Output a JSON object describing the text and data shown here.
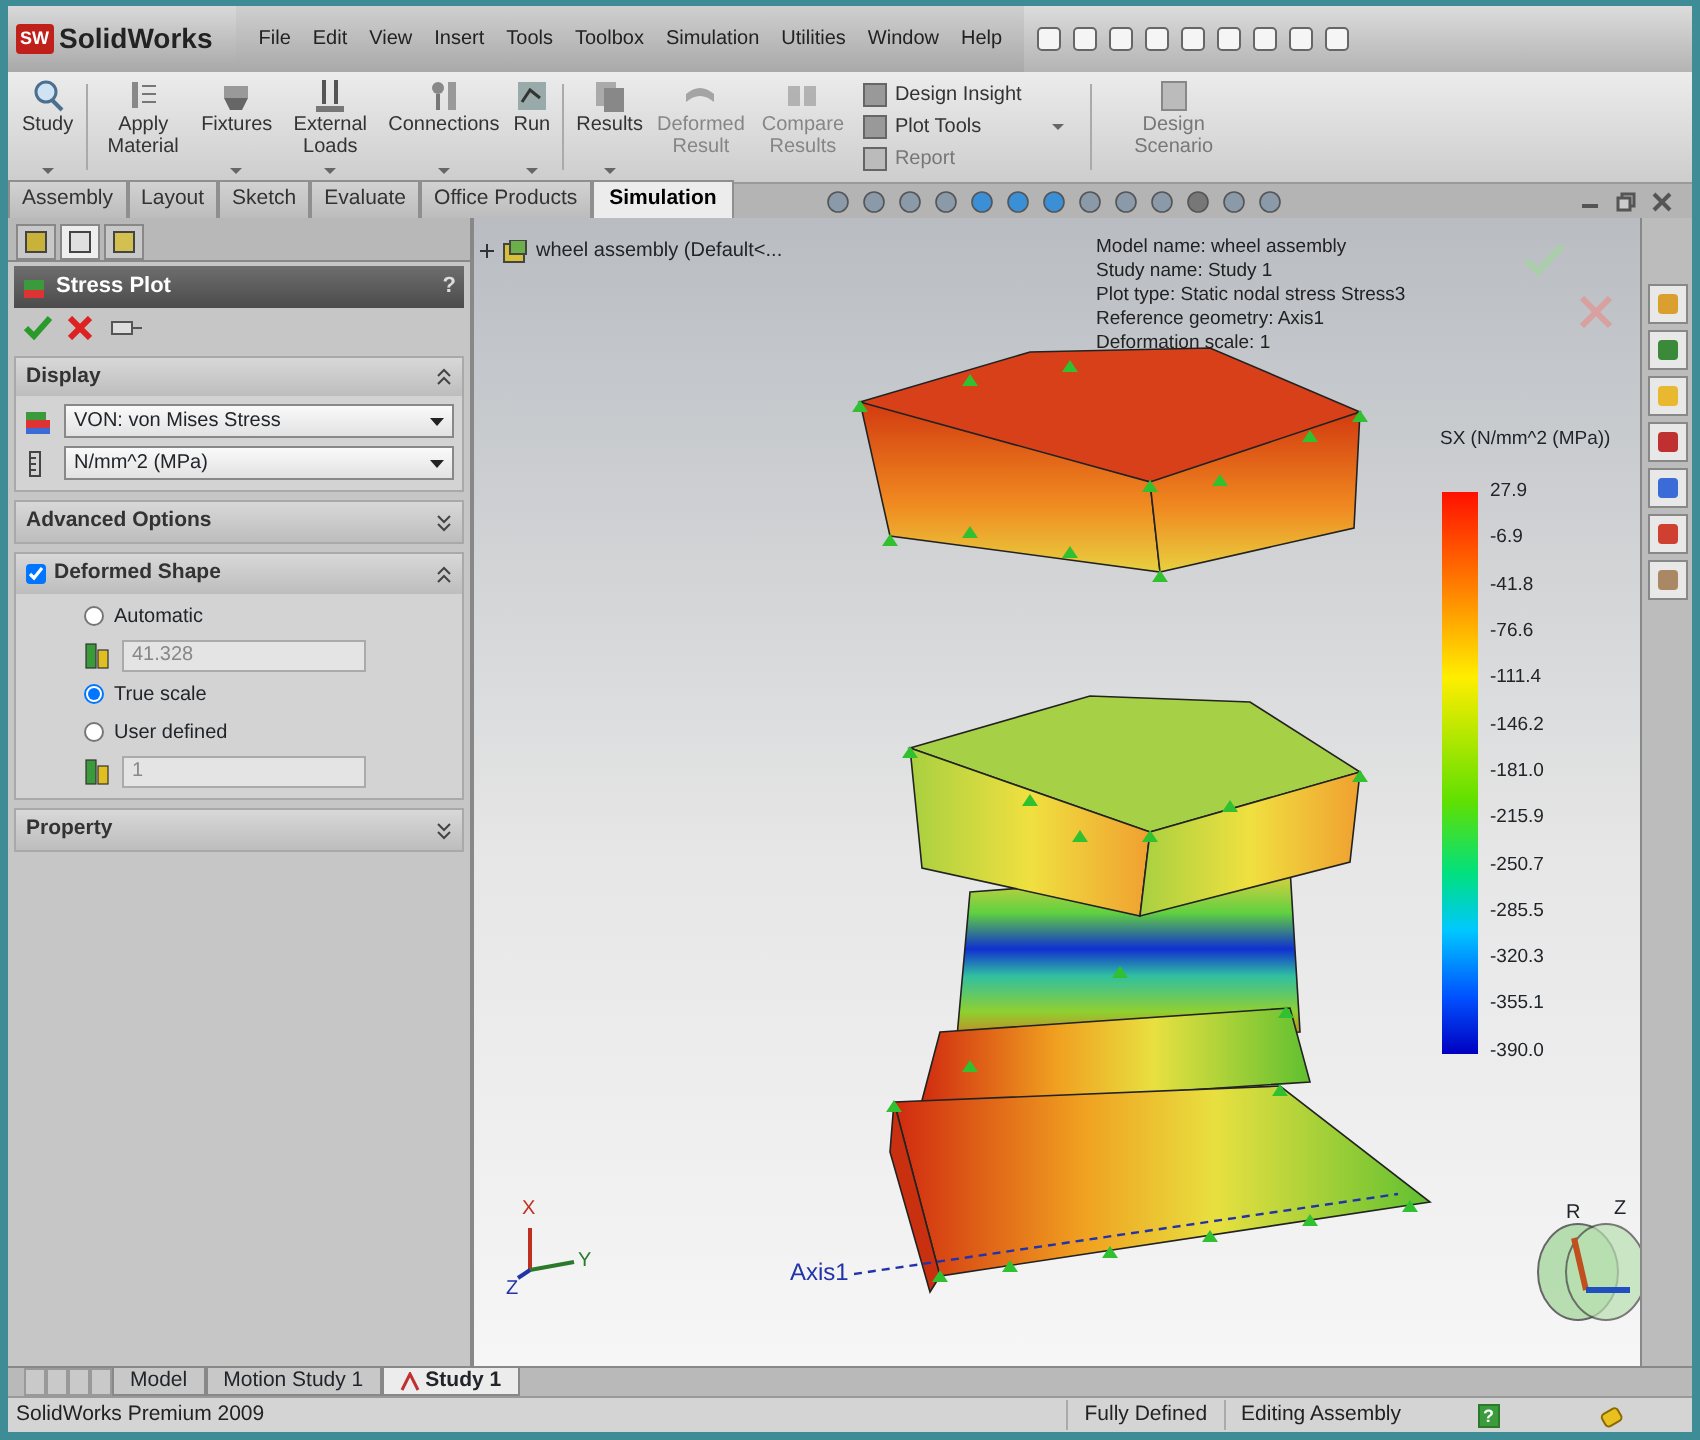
{
  "app": {
    "logo_badge": "SW",
    "logo": "SolidWorks",
    "menu": [
      "File",
      "Edit",
      "View",
      "Insert",
      "Tools",
      "Toolbox",
      "Simulation",
      "Utilities",
      "Window",
      "Help"
    ]
  },
  "ribbon": {
    "tools": [
      {
        "label": "Study",
        "has_menu": true,
        "disabled": false
      },
      {
        "label": "Apply Material",
        "has_menu": false,
        "disabled": false
      },
      {
        "label": "Fixtures",
        "has_menu": true,
        "disabled": false
      },
      {
        "label": "External Loads",
        "has_menu": true,
        "disabled": false
      },
      {
        "label": "Connections",
        "has_menu": true,
        "disabled": false
      },
      {
        "label": "Run",
        "has_menu": true,
        "disabled": false
      },
      {
        "label": "Results",
        "has_menu": true,
        "disabled": false
      },
      {
        "label": "Deformed Result",
        "has_menu": false,
        "disabled": true
      },
      {
        "label": "Compare Results",
        "has_menu": false,
        "disabled": true
      }
    ],
    "small_tools": [
      {
        "label": "Design Insight",
        "disabled": false
      },
      {
        "label": "Plot Tools",
        "disabled": false
      },
      {
        "label": "Report",
        "disabled": true
      }
    ],
    "last_tool": {
      "label": "Design Scenario",
      "disabled": true
    }
  },
  "tabs": [
    {
      "label": "Assembly",
      "selected": false
    },
    {
      "label": "Layout",
      "selected": false
    },
    {
      "label": "Sketch",
      "selected": false
    },
    {
      "label": "Evaluate",
      "selected": false
    },
    {
      "label": "Office Products",
      "selected": false
    },
    {
      "label": "Simulation",
      "selected": true
    }
  ],
  "panel": {
    "tabs": [
      {
        "selected": false
      },
      {
        "selected": true
      },
      {
        "selected": false
      }
    ],
    "title": "Stress Plot",
    "help": "?",
    "sections": [
      {
        "kind": "display",
        "title": "Display",
        "expanded": true,
        "dropdowns": [
          "VON: von Mises Stress",
          "N/mm^2 (MPa)"
        ]
      },
      {
        "kind": "plain",
        "title": "Advanced Options",
        "expanded": false
      },
      {
        "kind": "deformed",
        "title": "Deformed Shape",
        "expanded": true,
        "checked": true,
        "options": [
          {
            "label": "Automatic",
            "selected": false
          },
          {
            "value": "41.328",
            "disabled": true
          },
          {
            "label": "True scale",
            "selected": true
          },
          {
            "label": "User defined",
            "selected": false
          },
          {
            "value": "1",
            "disabled": true
          }
        ]
      },
      {
        "kind": "plain",
        "title": "Property",
        "expanded": false
      }
    ]
  },
  "viewport": {
    "tree_item": "wheel assembly  (Default<...",
    "info": [
      "Model name: wheel assembly",
      "Study name: Study 1",
      "Plot type: Static nodal stress Stress3",
      "Reference geometry: Axis1",
      "Deformation scale: 1"
    ],
    "legend": {
      "title": "SX (N/mm^2 (MPa))",
      "labels": [
        "27.9",
        "-6.9",
        "-41.8",
        "-76.6",
        "-111.4",
        "-146.2",
        "-181.0",
        "-215.9",
        "-250.7",
        "-285.5",
        "-320.3",
        "-355.1",
        "-390.0"
      ]
    },
    "axis_label": "Axis1",
    "triad_labels": [
      "X",
      "Y",
      "Z"
    ],
    "view_triad_labels": [
      "R",
      "Z"
    ]
  },
  "bottom_tabs": [
    {
      "label": "Model",
      "selected": false
    },
    {
      "label": "Motion Study 1",
      "selected": false
    },
    {
      "label": "Study 1",
      "selected": true
    }
  ],
  "status": {
    "product": "SolidWorks Premium 2009",
    "items": [
      "Fully Defined",
      "Editing Assembly"
    ],
    "help": "?"
  }
}
